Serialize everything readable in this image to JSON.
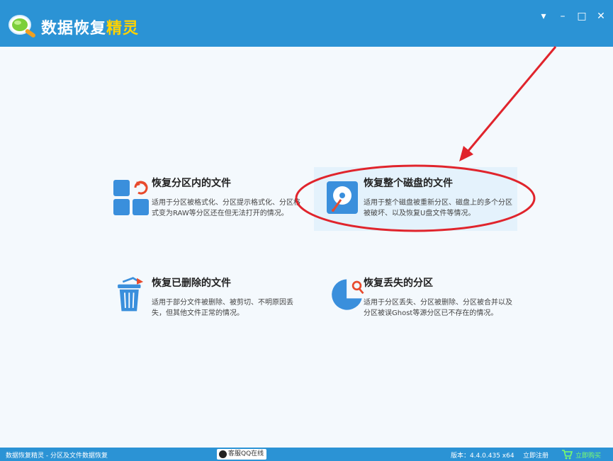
{
  "window": {
    "title_main": "数据恢复",
    "title_accent": "精灵",
    "controls": {
      "menu": "▾",
      "minimize": "–",
      "maximize": "□",
      "close": "✕"
    }
  },
  "cards": [
    {
      "title": "恢复分区内的文件",
      "desc": "适用于分区被格式化、分区提示格式化、分区格式变为RAW等分区还在但无法打开的情况。",
      "icon": "partition-files-icon"
    },
    {
      "title": "恢复整个磁盘的文件",
      "desc": "适用于整个磁盘被重新分区、磁盘上的多个分区被破坏、以及恢复U盘文件等情况。",
      "icon": "hard-disk-icon"
    },
    {
      "title": "恢复已删除的文件",
      "desc": "适用于部分文件被删除、被剪切、不明原因丢失，但其他文件正常的情况。",
      "icon": "recycle-bin-icon"
    },
    {
      "title": "恢复丢失的分区",
      "desc": "适用于分区丢失、分区被删除、分区被合并以及分区被误Ghost等源分区已不存在的情况。",
      "icon": "lost-partition-icon"
    }
  ],
  "status": {
    "app_info": "数据恢复精灵 - 分区及文件数据恢复",
    "qq_support": "客服QQ在线",
    "version": "版本：4.4.0.435 x64",
    "register": "立即注册",
    "buy": "立即购买"
  },
  "colors": {
    "titlebar": "#2b93d5",
    "accent": "#ffd200",
    "highlight": "#e4f2fc",
    "annotation_red": "#e0242c"
  }
}
